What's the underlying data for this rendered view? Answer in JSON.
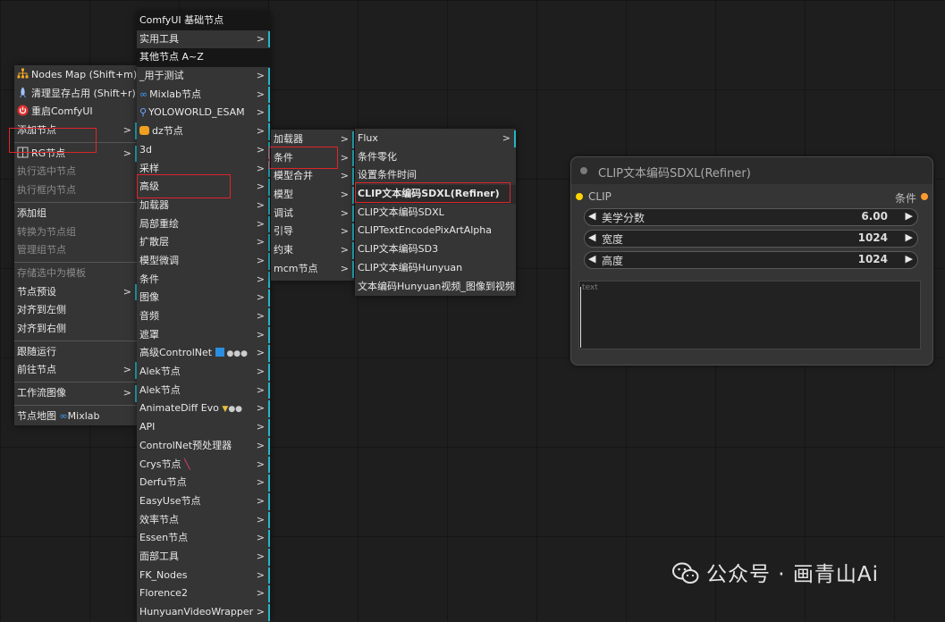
{
  "menu1": {
    "nodes_map": "Nodes Map (Shift+m)",
    "clear_vram": "清理显存占用 (Shift+r)",
    "restart": "重启ComfyUI",
    "add_node": "添加节点",
    "rg_node": "RG节点",
    "exec_selected": "执行选中节点",
    "exec_in_frame": "执行框内节点",
    "add_group": "添加组",
    "convert_group": "转换为节点组",
    "manage_group": "管理组节点",
    "save_template": "存储选中为模板",
    "node_preset": "节点预设",
    "align_left": "对齐到左侧",
    "align_right": "对齐到右侧",
    "follow_run": "跟随运行",
    "goto_node": "前往节点",
    "workflow_image": "工作流图像",
    "node_map": "节点地图",
    "mixlab": "Mixlab"
  },
  "menu2": {
    "header1": "ComfyUI 基础节点",
    "tools": "实用工具",
    "header2": "其他节点 A~Z",
    "items": [
      "_用于测试",
      "Mixlab节点",
      "YOLOWORLD_ESAM",
      "dz节点",
      "3d",
      "采样",
      "高级",
      "加载器",
      "局部重绘",
      "扩散层",
      "模型微调",
      "条件",
      "图像",
      "音频",
      "遮罩",
      "高级ControlNet",
      "Alek节点",
      "Alek节点",
      "AnimateDiff Evo",
      "API",
      "ControlNet预处理器",
      "Crys节点",
      "Derfu节点",
      "EasyUse节点",
      "效率节点",
      "Essen节点",
      "面部工具",
      "FK_Nodes",
      "Florence2",
      "HunyuanVideoWrapper"
    ]
  },
  "menu3": {
    "items": [
      "加载器",
      "条件",
      "模型合并",
      "模型",
      "调试",
      "引导",
      "约束",
      "mcm节点"
    ]
  },
  "menu4": {
    "items": [
      "Flux",
      "条件零化",
      "设置条件时间",
      "CLIP文本编码SDXL(Refiner)",
      "CLIP文本编码SDXL",
      "CLIPTextEncodePixArtAlpha",
      "CLIP文本编码SD3",
      "CLIP文本编码Hunyuan",
      "文本编码Hunyuan视频_图像到视频"
    ]
  },
  "node": {
    "title": "CLIP文本编码SDXL(Refiner)",
    "input": "CLIP",
    "output": "条件",
    "widgets": [
      {
        "name": "美学分数",
        "value": "6.00"
      },
      {
        "name": "宽度",
        "value": "1024"
      },
      {
        "name": "高度",
        "value": "1024"
      }
    ],
    "text_placeholder": "text"
  },
  "watermark": "公众号 · 画青山Ai",
  "colors": {
    "accent": "#25b6c6",
    "highlight_box": "#e0242c",
    "clip_slot": "#ffd500",
    "cond_slot": "#ff9a2e"
  }
}
